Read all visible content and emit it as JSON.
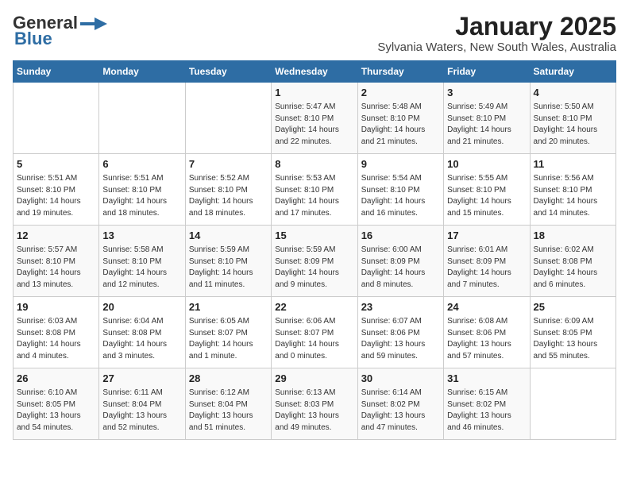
{
  "logo": {
    "general": "General",
    "blue": "Blue"
  },
  "title": "January 2025",
  "subtitle": "Sylvania Waters, New South Wales, Australia",
  "days_header": [
    "Sunday",
    "Monday",
    "Tuesday",
    "Wednesday",
    "Thursday",
    "Friday",
    "Saturday"
  ],
  "weeks": [
    [
      {
        "day": "",
        "info": ""
      },
      {
        "day": "",
        "info": ""
      },
      {
        "day": "",
        "info": ""
      },
      {
        "day": "1",
        "info": "Sunrise: 5:47 AM\nSunset: 8:10 PM\nDaylight: 14 hours\nand 22 minutes."
      },
      {
        "day": "2",
        "info": "Sunrise: 5:48 AM\nSunset: 8:10 PM\nDaylight: 14 hours\nand 21 minutes."
      },
      {
        "day": "3",
        "info": "Sunrise: 5:49 AM\nSunset: 8:10 PM\nDaylight: 14 hours\nand 21 minutes."
      },
      {
        "day": "4",
        "info": "Sunrise: 5:50 AM\nSunset: 8:10 PM\nDaylight: 14 hours\nand 20 minutes."
      }
    ],
    [
      {
        "day": "5",
        "info": "Sunrise: 5:51 AM\nSunset: 8:10 PM\nDaylight: 14 hours\nand 19 minutes."
      },
      {
        "day": "6",
        "info": "Sunrise: 5:51 AM\nSunset: 8:10 PM\nDaylight: 14 hours\nand 18 minutes."
      },
      {
        "day": "7",
        "info": "Sunrise: 5:52 AM\nSunset: 8:10 PM\nDaylight: 14 hours\nand 18 minutes."
      },
      {
        "day": "8",
        "info": "Sunrise: 5:53 AM\nSunset: 8:10 PM\nDaylight: 14 hours\nand 17 minutes."
      },
      {
        "day": "9",
        "info": "Sunrise: 5:54 AM\nSunset: 8:10 PM\nDaylight: 14 hours\nand 16 minutes."
      },
      {
        "day": "10",
        "info": "Sunrise: 5:55 AM\nSunset: 8:10 PM\nDaylight: 14 hours\nand 15 minutes."
      },
      {
        "day": "11",
        "info": "Sunrise: 5:56 AM\nSunset: 8:10 PM\nDaylight: 14 hours\nand 14 minutes."
      }
    ],
    [
      {
        "day": "12",
        "info": "Sunrise: 5:57 AM\nSunset: 8:10 PM\nDaylight: 14 hours\nand 13 minutes."
      },
      {
        "day": "13",
        "info": "Sunrise: 5:58 AM\nSunset: 8:10 PM\nDaylight: 14 hours\nand 12 minutes."
      },
      {
        "day": "14",
        "info": "Sunrise: 5:59 AM\nSunset: 8:10 PM\nDaylight: 14 hours\nand 11 minutes."
      },
      {
        "day": "15",
        "info": "Sunrise: 5:59 AM\nSunset: 8:09 PM\nDaylight: 14 hours\nand 9 minutes."
      },
      {
        "day": "16",
        "info": "Sunrise: 6:00 AM\nSunset: 8:09 PM\nDaylight: 14 hours\nand 8 minutes."
      },
      {
        "day": "17",
        "info": "Sunrise: 6:01 AM\nSunset: 8:09 PM\nDaylight: 14 hours\nand 7 minutes."
      },
      {
        "day": "18",
        "info": "Sunrise: 6:02 AM\nSunset: 8:08 PM\nDaylight: 14 hours\nand 6 minutes."
      }
    ],
    [
      {
        "day": "19",
        "info": "Sunrise: 6:03 AM\nSunset: 8:08 PM\nDaylight: 14 hours\nand 4 minutes."
      },
      {
        "day": "20",
        "info": "Sunrise: 6:04 AM\nSunset: 8:08 PM\nDaylight: 14 hours\nand 3 minutes."
      },
      {
        "day": "21",
        "info": "Sunrise: 6:05 AM\nSunset: 8:07 PM\nDaylight: 14 hours\nand 1 minute."
      },
      {
        "day": "22",
        "info": "Sunrise: 6:06 AM\nSunset: 8:07 PM\nDaylight: 14 hours\nand 0 minutes."
      },
      {
        "day": "23",
        "info": "Sunrise: 6:07 AM\nSunset: 8:06 PM\nDaylight: 13 hours\nand 59 minutes."
      },
      {
        "day": "24",
        "info": "Sunrise: 6:08 AM\nSunset: 8:06 PM\nDaylight: 13 hours\nand 57 minutes."
      },
      {
        "day": "25",
        "info": "Sunrise: 6:09 AM\nSunset: 8:05 PM\nDaylight: 13 hours\nand 55 minutes."
      }
    ],
    [
      {
        "day": "26",
        "info": "Sunrise: 6:10 AM\nSunset: 8:05 PM\nDaylight: 13 hours\nand 54 minutes."
      },
      {
        "day": "27",
        "info": "Sunrise: 6:11 AM\nSunset: 8:04 PM\nDaylight: 13 hours\nand 52 minutes."
      },
      {
        "day": "28",
        "info": "Sunrise: 6:12 AM\nSunset: 8:04 PM\nDaylight: 13 hours\nand 51 minutes."
      },
      {
        "day": "29",
        "info": "Sunrise: 6:13 AM\nSunset: 8:03 PM\nDaylight: 13 hours\nand 49 minutes."
      },
      {
        "day": "30",
        "info": "Sunrise: 6:14 AM\nSunset: 8:02 PM\nDaylight: 13 hours\nand 47 minutes."
      },
      {
        "day": "31",
        "info": "Sunrise: 6:15 AM\nSunset: 8:02 PM\nDaylight: 13 hours\nand 46 minutes."
      },
      {
        "day": "",
        "info": ""
      }
    ]
  ]
}
